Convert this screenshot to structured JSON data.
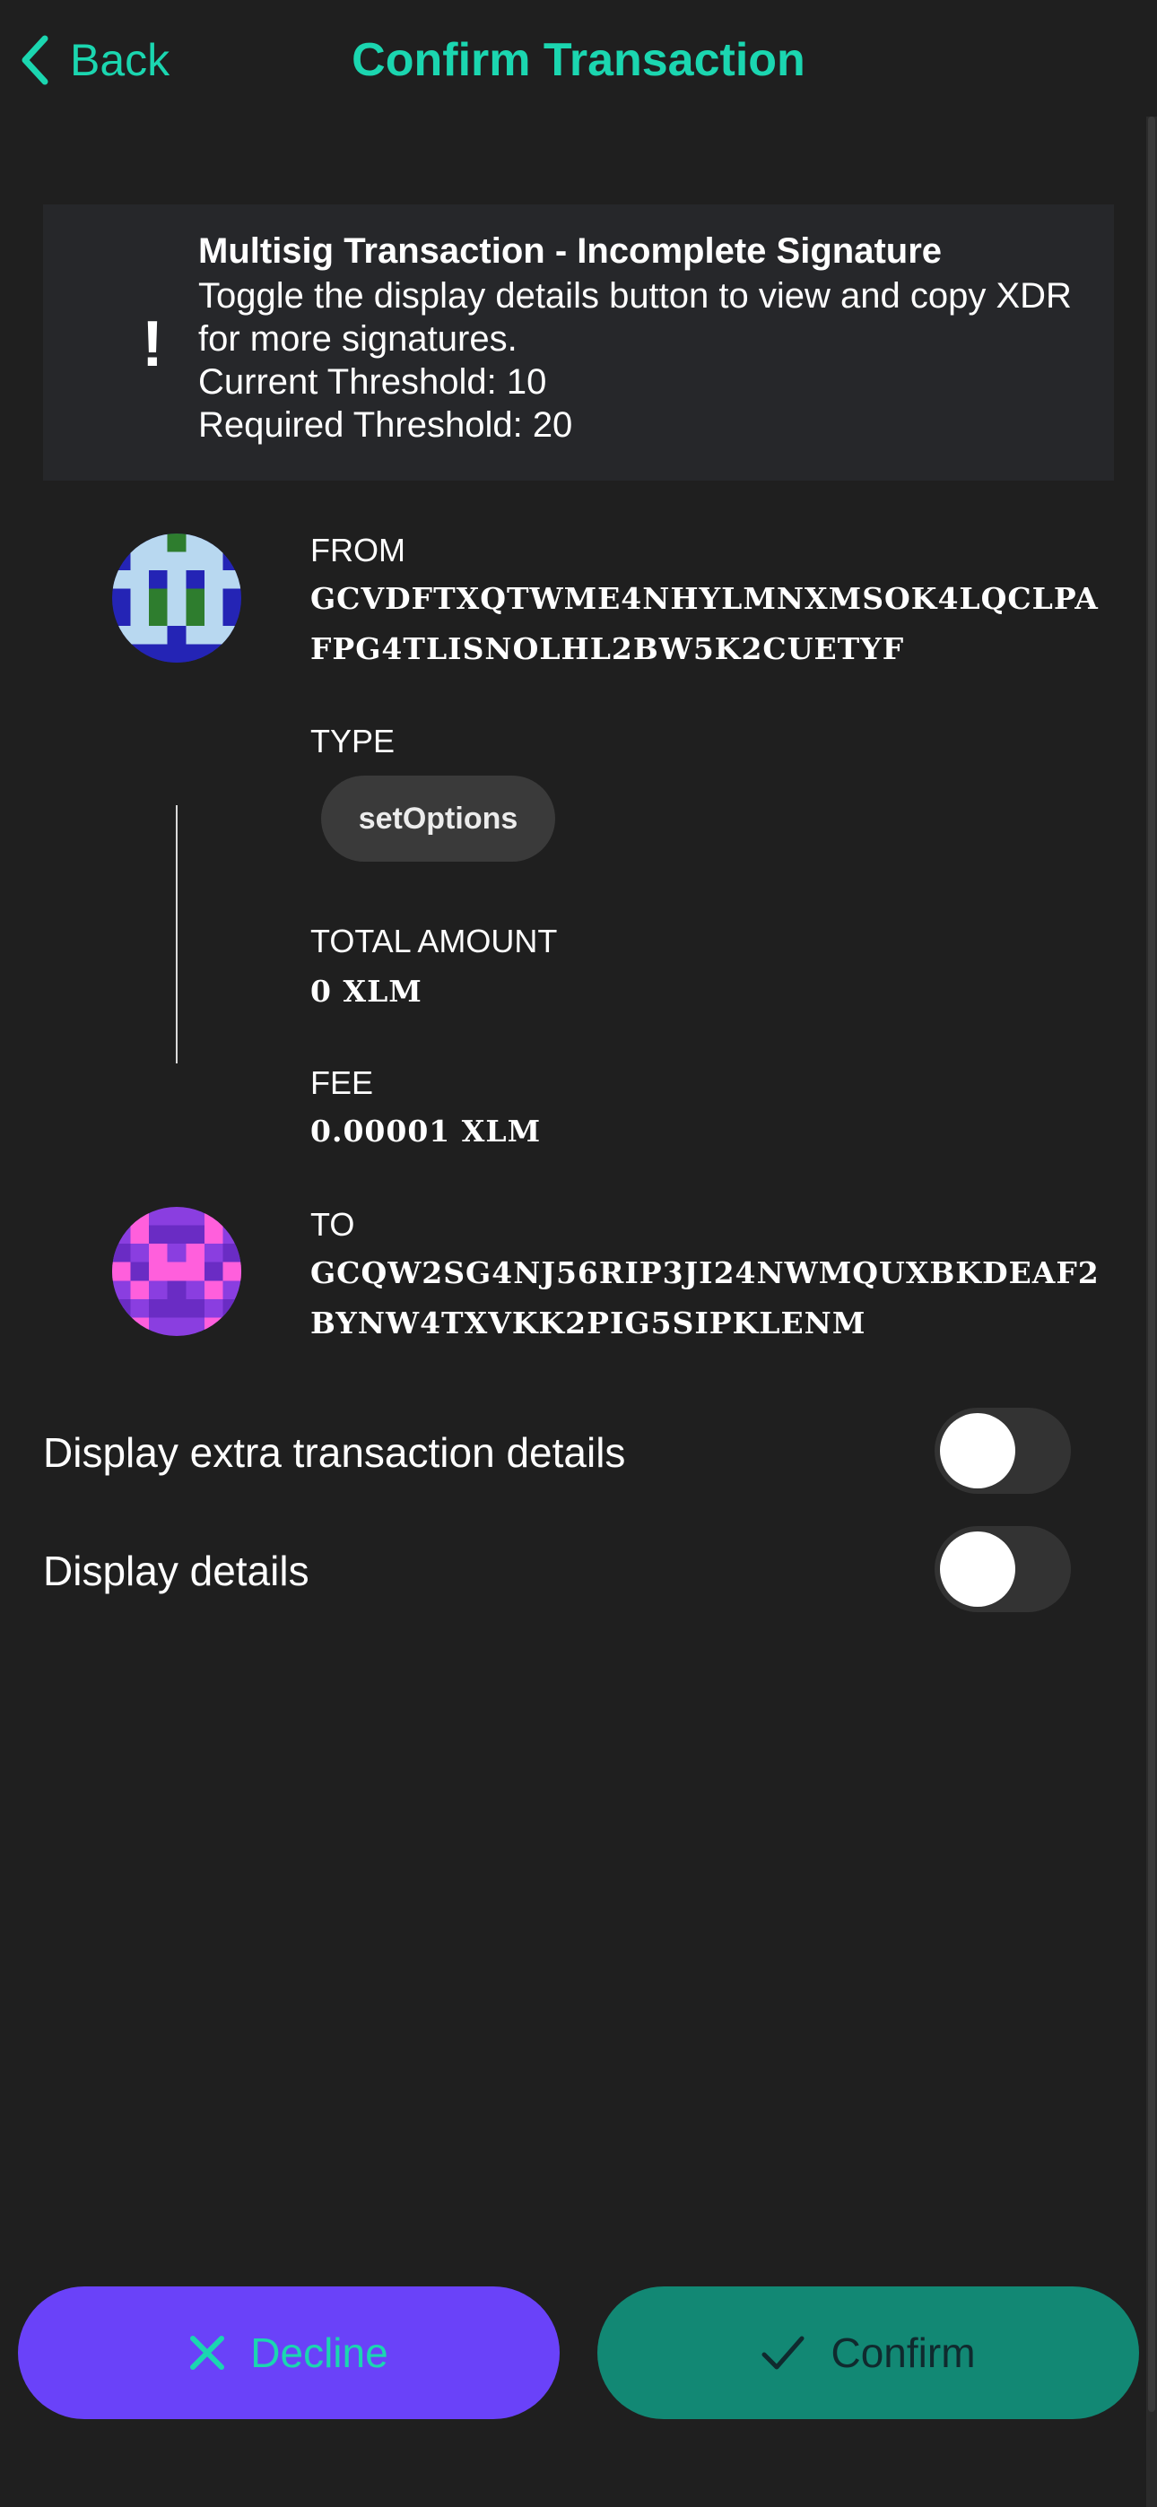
{
  "header": {
    "back_label": "Back",
    "title": "Confirm Transaction"
  },
  "warning": {
    "icon": "!",
    "title": "Multisig Transaction - Incomplete Signature",
    "line1": "Toggle the display details button to view and copy XDR for more signatures.",
    "line2": "Current Threshold: 10",
    "line3": "Required Threshold: 20"
  },
  "transaction": {
    "from_label": "FROM",
    "from_address": "GCVDFTXQTWME4NHYLMNXMSOK4LQCLPAFPG4TLISNOLHL2BW5K2CUETYF",
    "type_label": "TYPE",
    "type_value": "setOptions",
    "amount_label": "TOTAL AMOUNT",
    "amount_value": "0",
    "amount_unit": "XLM",
    "fee_label": "FEE",
    "fee_value": "0.00001",
    "fee_unit": "XLM",
    "to_label": "TO",
    "to_address": "GCQW2SG4NJ56RIP3JI24NWMQUXBKDEAF2BYNW4TXVKK2PIG5SIPKLENM"
  },
  "toggles": [
    {
      "label": "Display extra transaction details",
      "on": false
    },
    {
      "label": "Display details",
      "on": false
    }
  ],
  "actions": {
    "decline_label": "Decline",
    "confirm_label": "Confirm"
  },
  "colors": {
    "accent": "#1bd6b0",
    "background": "#1f1f1f",
    "decline": "#6a42f9",
    "confirm": "#128874"
  }
}
